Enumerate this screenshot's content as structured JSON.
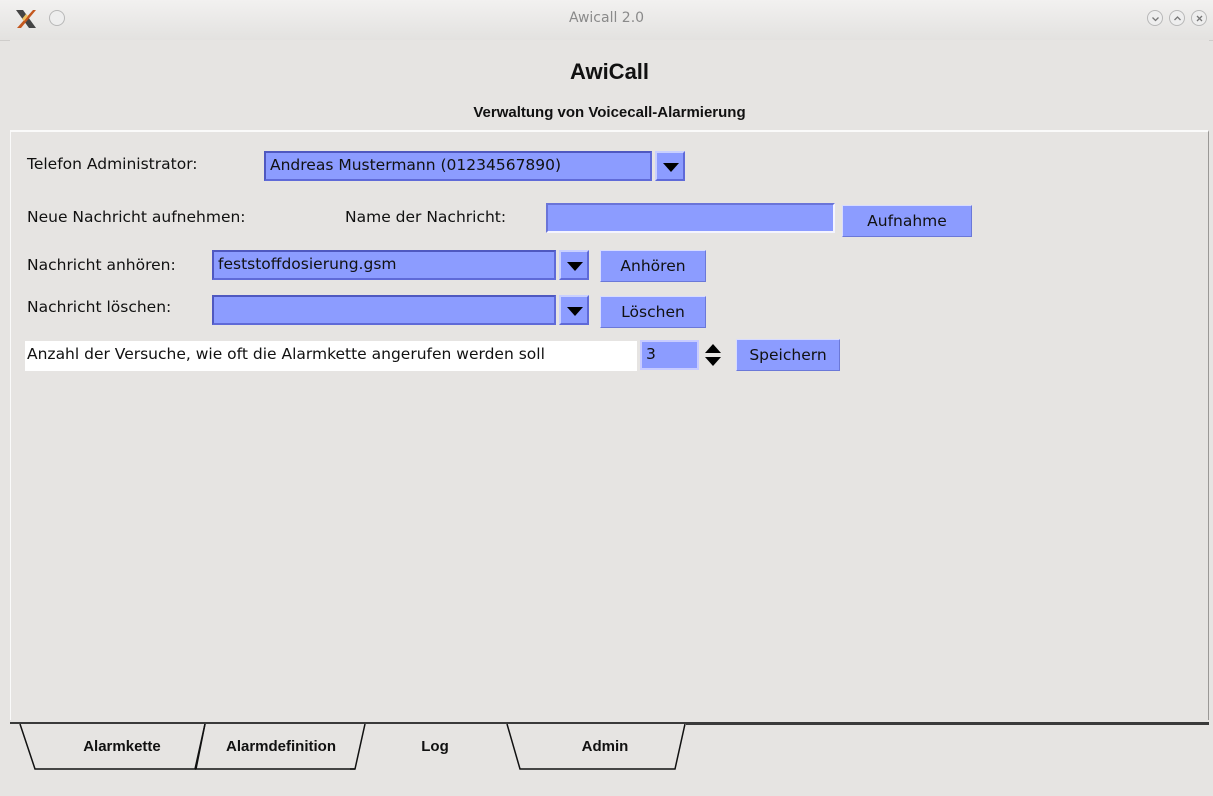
{
  "window": {
    "title": "Awicall 2.0"
  },
  "header": {
    "title": "AwiCall",
    "subtitle": "Verwaltung von Voicecall-Alarmierung"
  },
  "form": {
    "admin_label": "Telefon Administrator:",
    "admin_value": "Andreas Mustermann (01234567890)",
    "record_label": "Neue Nachricht aufnehmen:",
    "name_label": "Name der Nachricht:",
    "name_value": "",
    "record_button": "Aufnahme",
    "listen_label": "Nachricht anhören:",
    "listen_value": "feststoffdosierung.gsm",
    "listen_button": "Anhören",
    "delete_label": "Nachricht löschen:",
    "delete_value": "",
    "delete_button": "Löschen",
    "attempts_label": "Anzahl der Versuche, wie oft die Alarmkette angerufen werden soll",
    "attempts_value": "3",
    "save_button": "Speichern"
  },
  "tabs": [
    {
      "label": "Alarmkette",
      "active": false
    },
    {
      "label": "Alarmdefinition",
      "active": false
    },
    {
      "label": "Log",
      "active": false
    },
    {
      "label": "Admin",
      "active": true
    }
  ],
  "colors": {
    "control_fill": "#8c9cff",
    "background": "#e6e4e2"
  },
  "icons": {
    "app": "x-logo-icon",
    "menu": "circle-menu-icon",
    "minimize": "chevron-down-icon",
    "maximize": "chevron-up-icon",
    "close": "close-icon",
    "dropdown": "triangle-down-icon",
    "spinner": "up-down-arrows-icon"
  }
}
